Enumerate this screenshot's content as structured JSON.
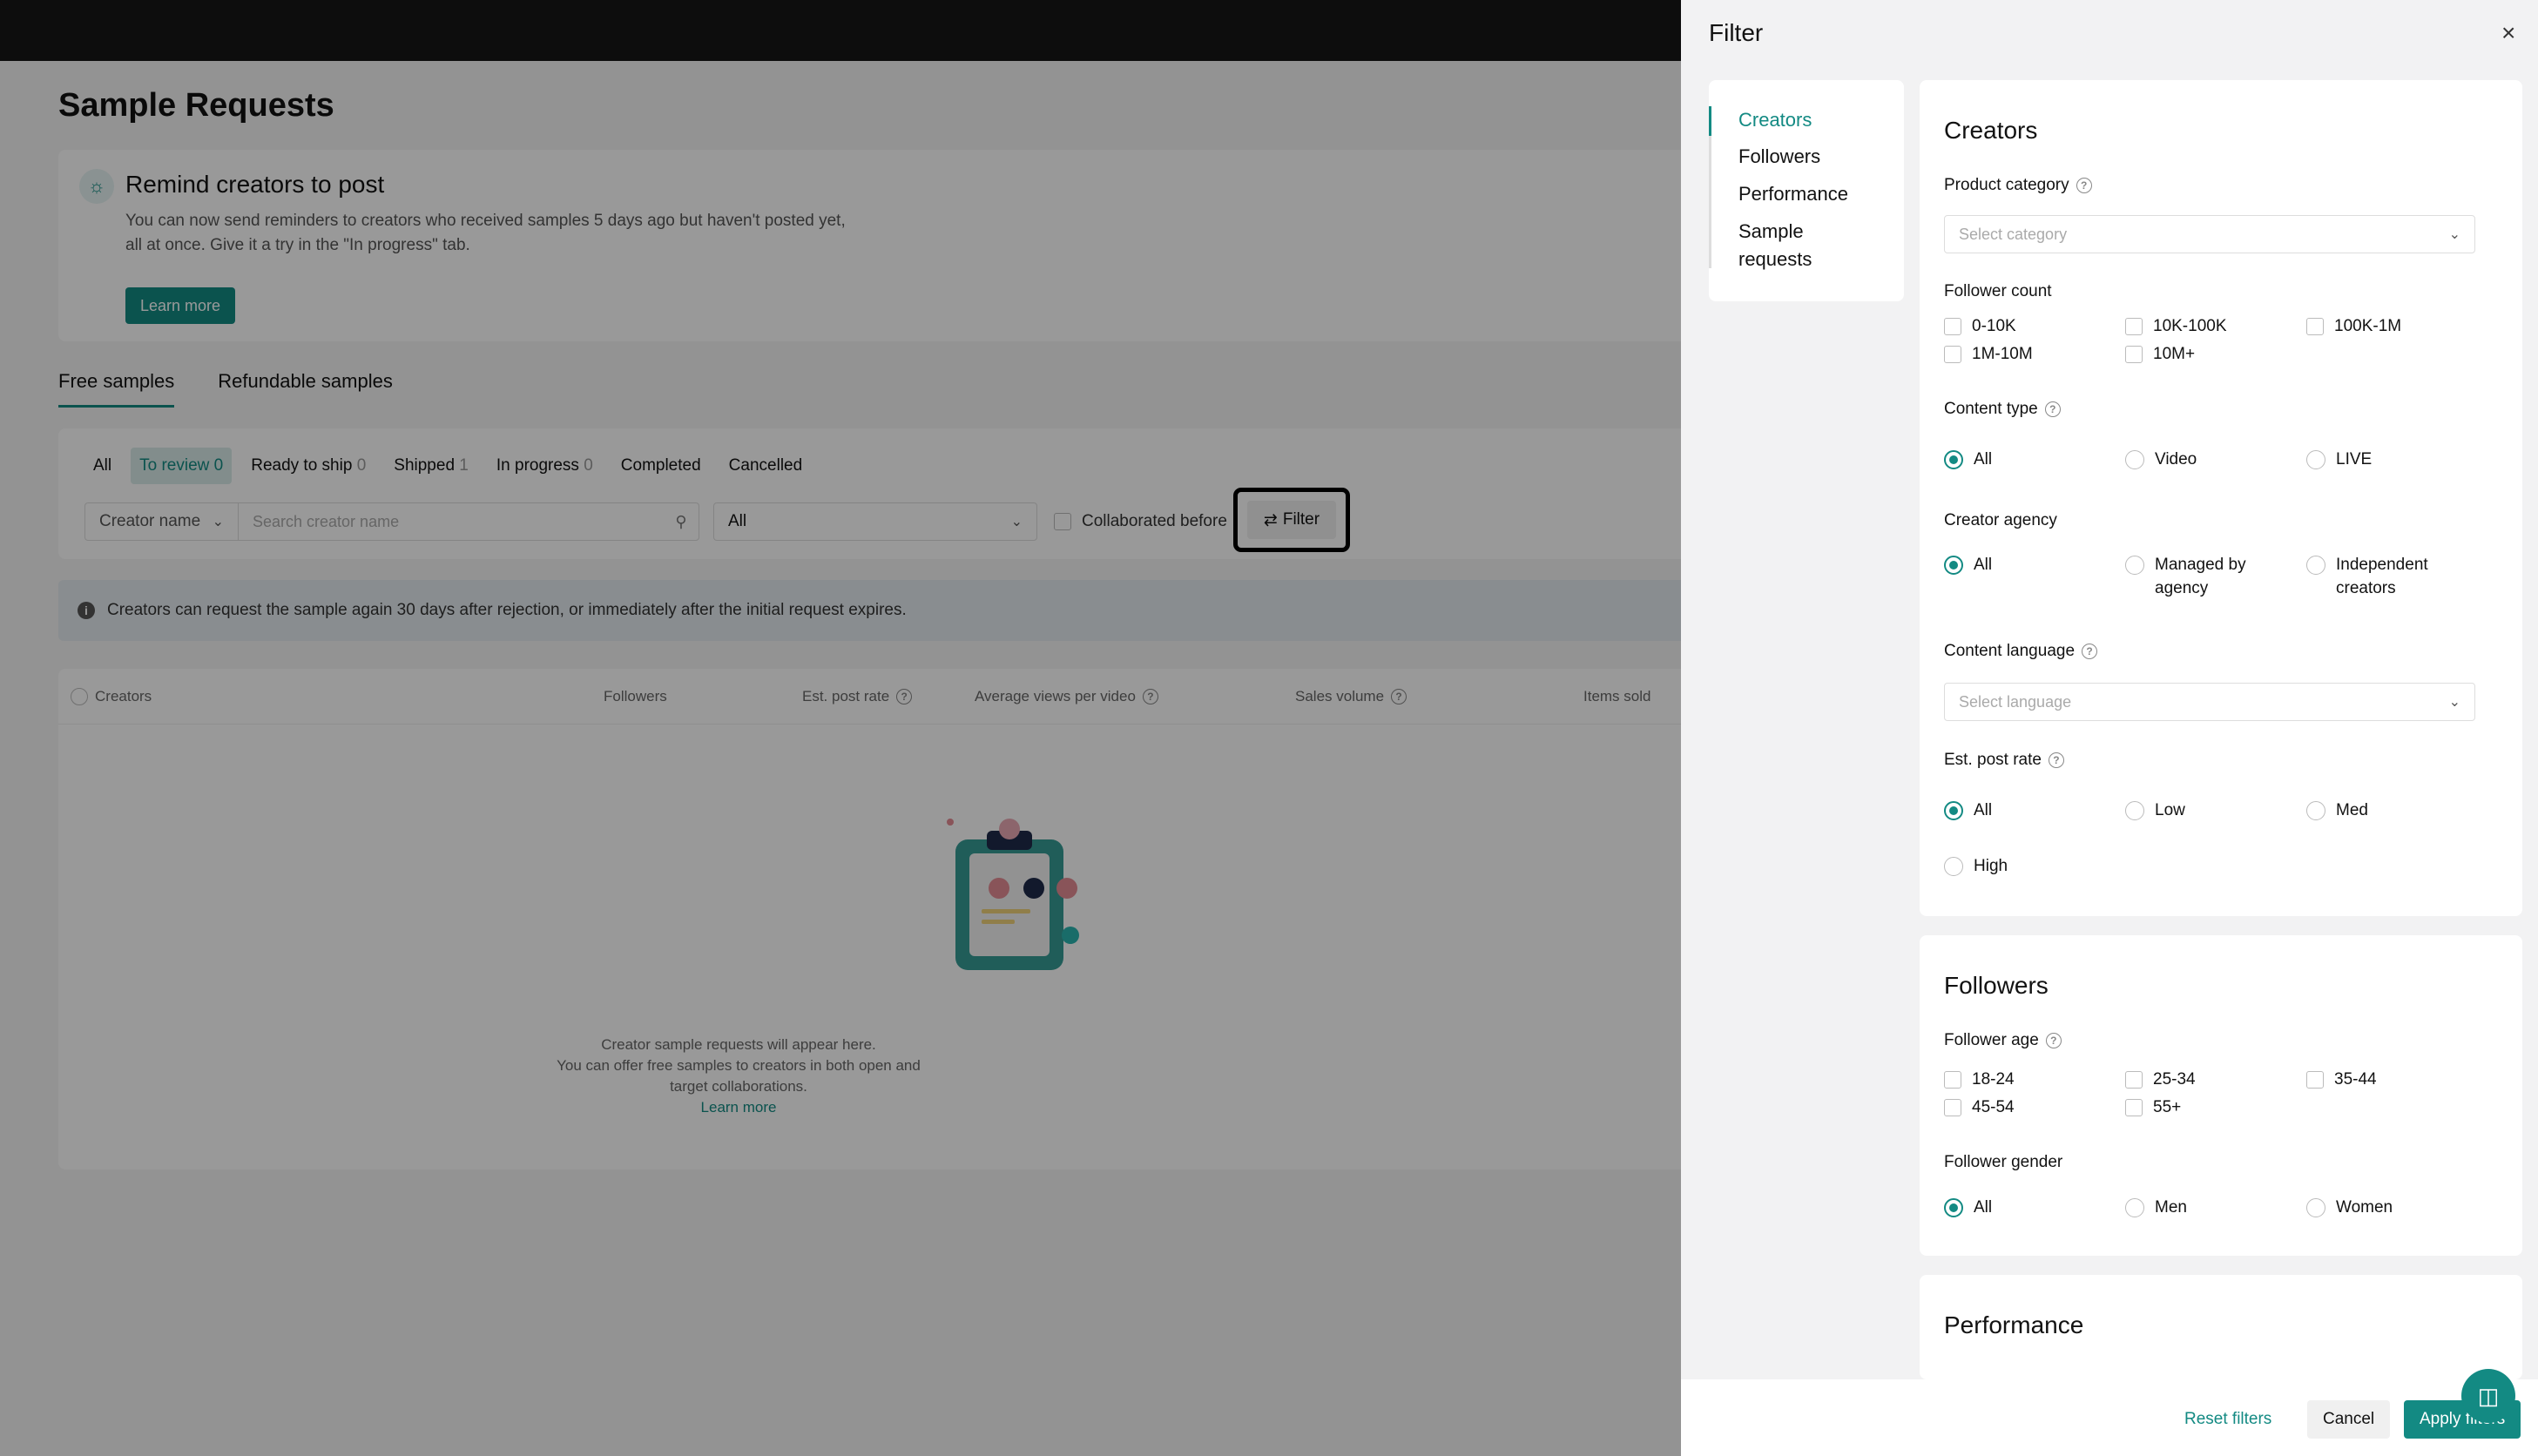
{
  "page": {
    "title": "Sample Requests"
  },
  "banner": {
    "title": "Remind creators to post",
    "text_line1": "You can now send reminders to creators who received samples 5 days ago but haven't posted yet,",
    "text_line2": "all at once. Give it a try in the \"In progress\" tab.",
    "button": "Learn more"
  },
  "tabs": [
    {
      "label": "Free samples",
      "active": true
    },
    {
      "label": "Refundable samples",
      "active": false
    }
  ],
  "status_tabs": [
    {
      "label": "All",
      "count": ""
    },
    {
      "label": "To review",
      "count": "0"
    },
    {
      "label": "Ready to ship",
      "count": "0"
    },
    {
      "label": "Shipped",
      "count": "1"
    },
    {
      "label": "In progress",
      "count": "0"
    },
    {
      "label": "Completed",
      "count": ""
    },
    {
      "label": "Cancelled",
      "count": ""
    }
  ],
  "search": {
    "selector": "Creator name",
    "placeholder": "Search creator name",
    "all_select": "All",
    "collab": "Collaborated before",
    "filter_button": "Filter"
  },
  "notice": "Creators can request the sample again 30 days after rejection, or immediately after the initial request expires.",
  "table": {
    "headers": [
      "Creators",
      "Followers",
      "Est. post rate",
      "Average views per video",
      "Sales volume",
      "Items sold"
    ],
    "empty_line1": "Creator sample requests will appear here.",
    "empty_line2": "You can offer free samples to creators in both open and",
    "empty_line3": "target collaborations.",
    "empty_link": "Learn more"
  },
  "panel": {
    "title": "Filter",
    "nav": [
      "Creators",
      "Followers",
      "Performance",
      "Sample",
      "requests"
    ],
    "creators": {
      "title": "Creators",
      "product_category": "Product category",
      "category_placeholder": "Select category",
      "follower_count": "Follower count",
      "follower_count_options": [
        "0-10K",
        "10K-100K",
        "100K-1M",
        "1M-10M",
        "10M+"
      ],
      "content_type": "Content type",
      "content_type_options": [
        "All",
        "Video",
        "LIVE"
      ],
      "creator_agency": "Creator agency",
      "agency_all": "All",
      "agency_managed1": "Managed by",
      "agency_managed2": "agency",
      "agency_indep1": "Independent",
      "agency_indep2": "creators",
      "content_language": "Content language",
      "language_placeholder": "Select language",
      "post_rate": "Est. post rate",
      "post_rate_options": [
        "All",
        "Low",
        "Med",
        "High"
      ]
    },
    "followers": {
      "title": "Followers",
      "age": "Follower age",
      "age_options": [
        "18-24",
        "25-34",
        "35-44",
        "45-54",
        "55+"
      ],
      "gender": "Follower gender",
      "gender_options": [
        "All",
        "Men",
        "Women"
      ]
    },
    "performance": {
      "title": "Performance"
    },
    "footer": {
      "reset": "Reset filters",
      "cancel": "Cancel",
      "apply": "Apply filters"
    }
  },
  "colors": {
    "accent": "#138a83",
    "topbar": "#161616"
  }
}
